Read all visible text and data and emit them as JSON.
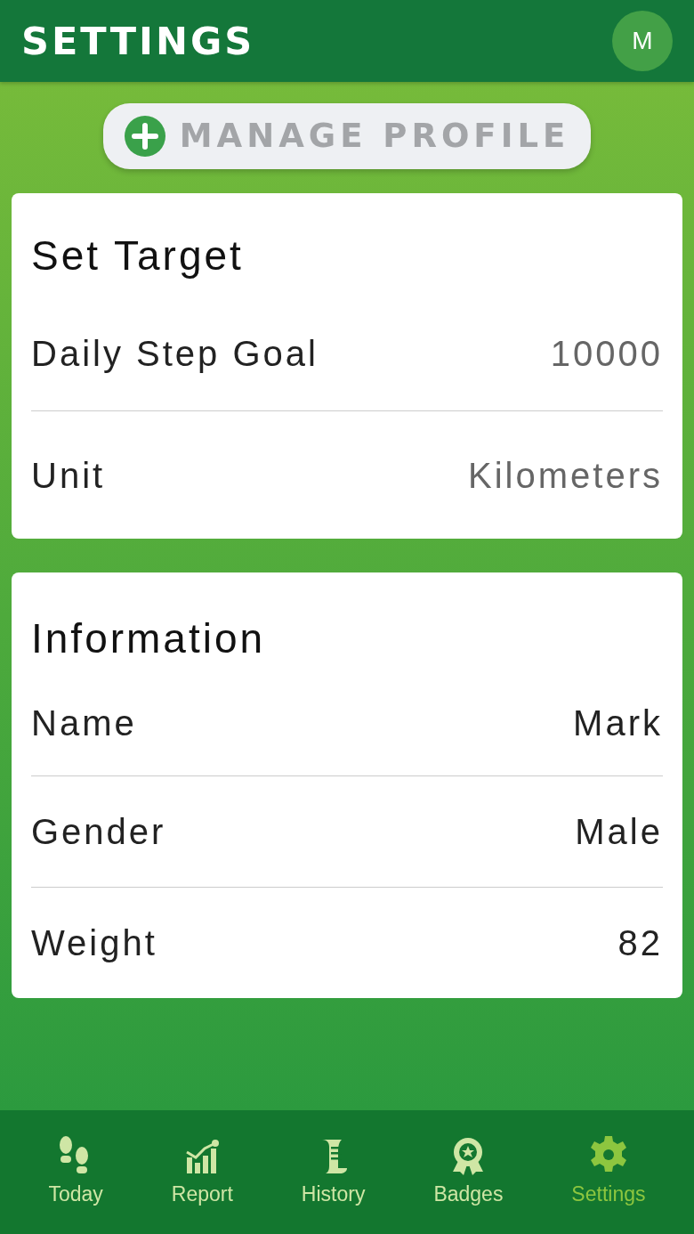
{
  "header": {
    "title": "SETTINGS",
    "avatar": "M"
  },
  "manage_button": {
    "label": "MANAGE PROFILE"
  },
  "sections": [
    {
      "title": "Set Target",
      "rows": [
        {
          "label": "Daily Step Goal",
          "value": "10000"
        },
        {
          "label": "Unit",
          "value": "Kilometers"
        }
      ]
    },
    {
      "title": "Information",
      "rows": [
        {
          "label": "Name",
          "value": "Mark"
        },
        {
          "label": "Gender",
          "value": "Male"
        },
        {
          "label": "Weight",
          "value": "82"
        }
      ]
    }
  ],
  "nav": [
    {
      "kind": "feet",
      "label": "Today",
      "selected": false
    },
    {
      "kind": "chart",
      "label": "Report",
      "selected": false
    },
    {
      "kind": "scroll",
      "label": "History",
      "selected": false
    },
    {
      "kind": "badge",
      "label": "Badges",
      "selected": false
    },
    {
      "kind": "gear",
      "label": "Settings",
      "selected": true
    }
  ]
}
